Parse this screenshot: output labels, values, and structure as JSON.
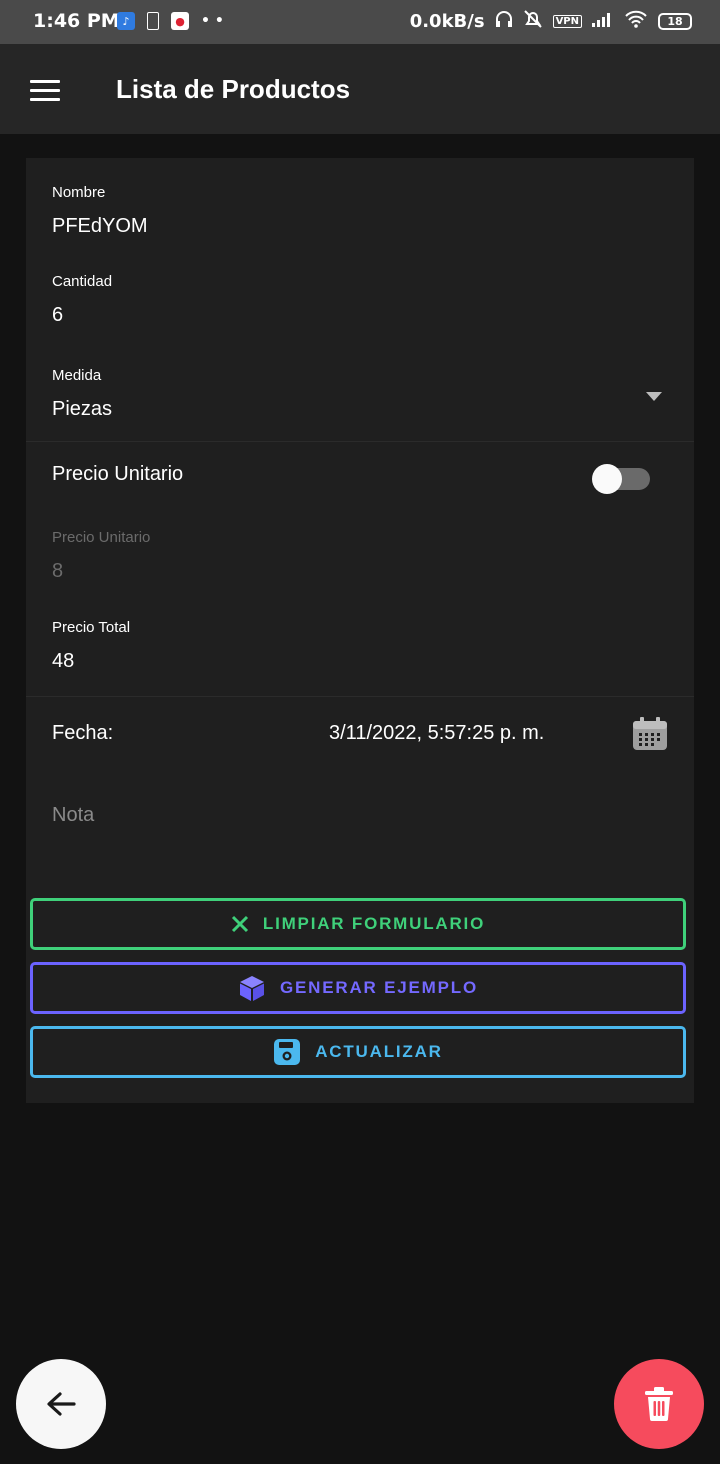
{
  "status_bar": {
    "time": "1:46 PM",
    "network_speed": "0.0kB/s",
    "vpn": "VPN",
    "battery": "18"
  },
  "app_bar": {
    "title": "Lista de Productos"
  },
  "form": {
    "nombre": {
      "label": "Nombre",
      "value": "PFEdYOM"
    },
    "cantidad": {
      "label": "Cantidad",
      "value": "6"
    },
    "medida": {
      "label": "Medida",
      "value": "Piezas"
    },
    "precio_toggle": {
      "label": "Precio Unitario",
      "on": false
    },
    "precio_unitario": {
      "label": "Precio Unitario",
      "value": "8"
    },
    "precio_total": {
      "label": "Precio Total",
      "value": "48"
    },
    "fecha": {
      "label": "Fecha:",
      "value": "3/11/2022, 5:57:25 p. m."
    },
    "nota": {
      "placeholder": "Nota"
    }
  },
  "buttons": {
    "clear": "LIMPIAR FORMULARIO",
    "generate": "GENERAR EJEMPLO",
    "update": "ACTUALIZAR"
  },
  "colors": {
    "clear": "#3fd07a",
    "generate": "#6c63ff",
    "update": "#4bb8ee",
    "delete_fab": "#f64b5d",
    "background": "#121212",
    "card": "#1f1f1f"
  }
}
